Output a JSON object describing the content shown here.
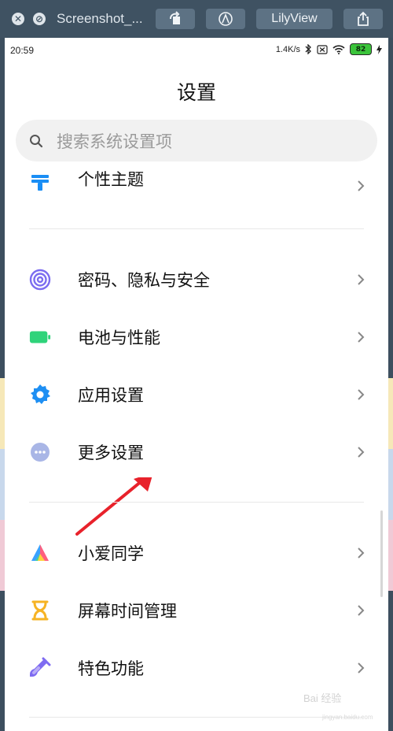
{
  "viewer": {
    "title": "Screenshot_...",
    "app_button_label": "LilyView",
    "icons": [
      "close-icon",
      "minimize-icon",
      "rotate-icon",
      "markup-icon",
      "share-icon"
    ]
  },
  "status_bar": {
    "time": "20:59",
    "network_speed": "1.4K/s",
    "battery_level": "82"
  },
  "header": {
    "title": "设置"
  },
  "search": {
    "placeholder": "搜索系统设置项"
  },
  "settings_items": [
    {
      "label": "个性主题",
      "icon": "theme-icon",
      "color": "#1a8ef5"
    },
    {
      "label": "密码、隐私与安全",
      "icon": "fingerprint-icon",
      "color": "#7b6cf0"
    },
    {
      "label": "电池与性能",
      "icon": "battery-icon",
      "color": "#2fd37a"
    },
    {
      "label": "应用设置",
      "icon": "gear-icon",
      "color": "#1e8ff3"
    },
    {
      "label": "更多设置",
      "icon": "more-icon",
      "color": "#a9b6e6"
    },
    {
      "label": "小爱同学",
      "icon": "xiaoai-icon",
      "color": "#ff5f7e"
    },
    {
      "label": "屏幕时间管理",
      "icon": "hourglass-icon",
      "color": "#f6b324"
    },
    {
      "label": "特色功能",
      "icon": "test-tube-icon",
      "color": "#7e6bf1"
    }
  ],
  "watermark": {
    "text": "Bai 经验",
    "sub": "jingyan.baidu.com"
  },
  "colors": {
    "annotation_arrow": "#e8222b",
    "viewer_bar": "#3f5262"
  }
}
